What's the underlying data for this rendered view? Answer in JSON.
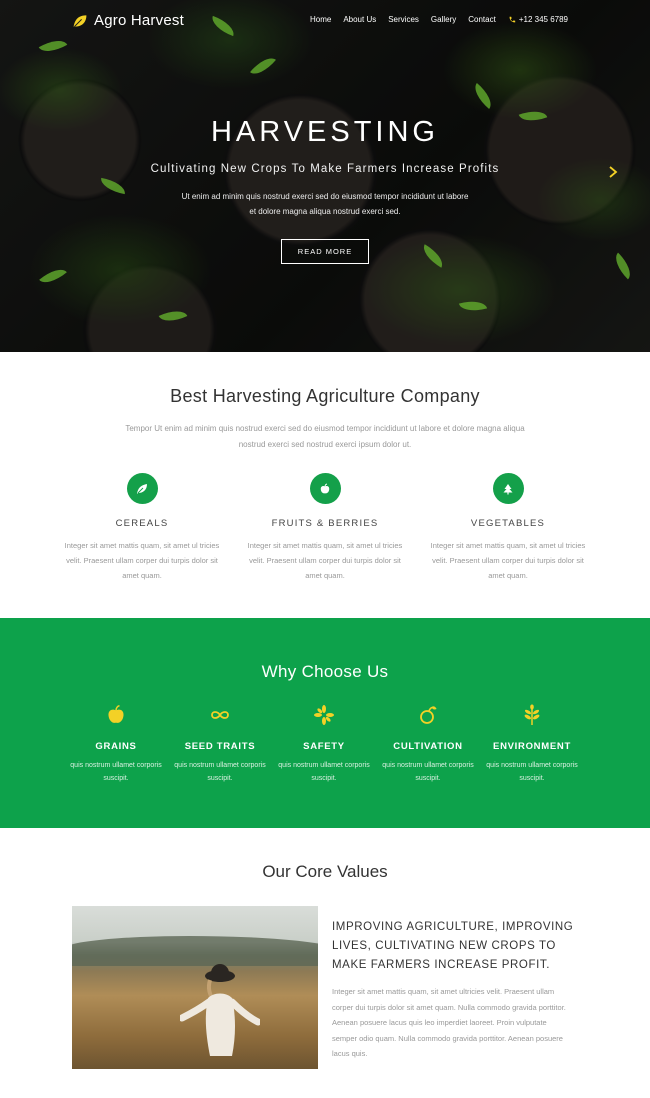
{
  "nav": {
    "brand": "Agro Harvest",
    "items": [
      "Home",
      "About Us",
      "Services",
      "Gallery",
      "Contact"
    ],
    "phone": "+12 345 6789"
  },
  "hero": {
    "title": "HARVESTING",
    "subtitle": "Cultivating New Crops To Make Farmers Increase Profits",
    "text": "Ut enim ad minim quis nostrud exerci sed do eiusmod tempor incididunt ut labore et dolore magna aliqua nostrud exerci sed.",
    "button": "READ MORE"
  },
  "about": {
    "title": "Best Harvesting Agriculture Company",
    "intro": "Tempor Ut enim ad minim quis nostrud exerci sed do eiusmod tempor incididunt ut labore et dolore magna aliqua nostrud exerci sed nostrud exerci ipsum dolor ut.",
    "features": [
      {
        "title": "CEREALS",
        "text": "Integer sit amet mattis quam, sit amet ul tricies velit. Praesent ullam corper dui turpis dolor sit amet quam.",
        "icon": "leaf-icon"
      },
      {
        "title": "FRUITS & BERRIES",
        "text": "Integer sit amet mattis quam, sit amet ul tricies velit. Praesent ullam corper dui turpis dolor sit amet quam.",
        "icon": "apple-icon"
      },
      {
        "title": "VEGETABLES",
        "text": "Integer sit amet mattis quam, sit amet ul tricies velit. Praesent ullam corper dui turpis dolor sit amet quam.",
        "icon": "tree-icon"
      }
    ]
  },
  "why": {
    "title": "Why Choose Us",
    "items": [
      {
        "title": "GRAINS",
        "text": "quis nostrum ullamet corporis suscipit.",
        "icon": "apple-icon"
      },
      {
        "title": "SEED TRAITS",
        "text": "quis nostrum ullamet corporis suscipit.",
        "icon": "infinity-icon"
      },
      {
        "title": "SAFETY",
        "text": "quis nostrum ullamet corporis suscipit.",
        "icon": "pinwheel-icon"
      },
      {
        "title": "CULTIVATION",
        "text": "quis nostrum ullamet corporis suscipit.",
        "icon": "fruit-icon"
      },
      {
        "title": "ENVIRONMENT",
        "text": "quis nostrum ullamet corporis suscipit.",
        "icon": "sprout-icon"
      }
    ]
  },
  "core": {
    "title": "Our Core Values",
    "heading": "IMPROVING AGRICULTURE, IMPROVING LIVES, CULTIVATING NEW CROPS TO MAKE FARMERS INCREASE PROFIT.",
    "text": "Integer sit amet mattis quam, sit amet ultricies velit. Praesent ullam corper dui turpis dolor sit amet quam. Nulla commodo gravida porttitor. Aenean posuere lacus quis leo imperdiet laoreet. Proin vulputate semper odio quam. Nulla commodo gravida porttitor. Aenean posuere lacus quis."
  },
  "colors": {
    "brand_green": "#0da24b",
    "accent_yellow": "#f3d126"
  }
}
